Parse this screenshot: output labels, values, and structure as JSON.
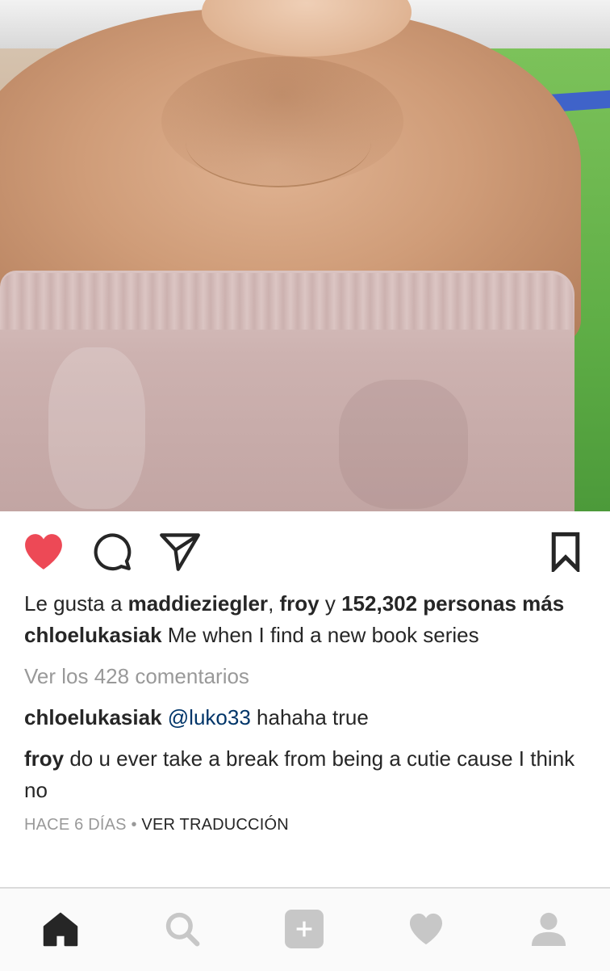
{
  "post": {
    "likes_prefix": "Le gusta a ",
    "liker_1": "maddieziegler",
    "sep": ", ",
    "liker_2": "froy",
    "and": " y ",
    "likes_count": "152,302 personas más",
    "caption_user": "chloelukasiak",
    "caption_text": " Me when I find a new book series",
    "view_comments": "Ver los 428 comentarios",
    "comments": [
      {
        "user": "chloelukasiak",
        "mention": "@luko33",
        "text": " hahaha true"
      },
      {
        "user": "froy",
        "mention": "",
        "text": " do u ever take a break from being a cutie cause I think no"
      }
    ],
    "time": "HACE 6 DÍAS",
    "dot": " • ",
    "translate": "VER TRADUCCIÓN"
  },
  "colors": {
    "like_red": "#ed4956",
    "text": "#262626",
    "muted": "#999999",
    "mention": "#003569"
  },
  "icons": {
    "like": "heart-filled-icon",
    "comment": "comment-bubble-icon",
    "share": "paper-plane-icon",
    "save": "bookmark-icon",
    "home": "home-icon",
    "search": "search-icon",
    "add": "plus-square-icon",
    "activity": "heart-icon",
    "profile": "profile-icon"
  }
}
